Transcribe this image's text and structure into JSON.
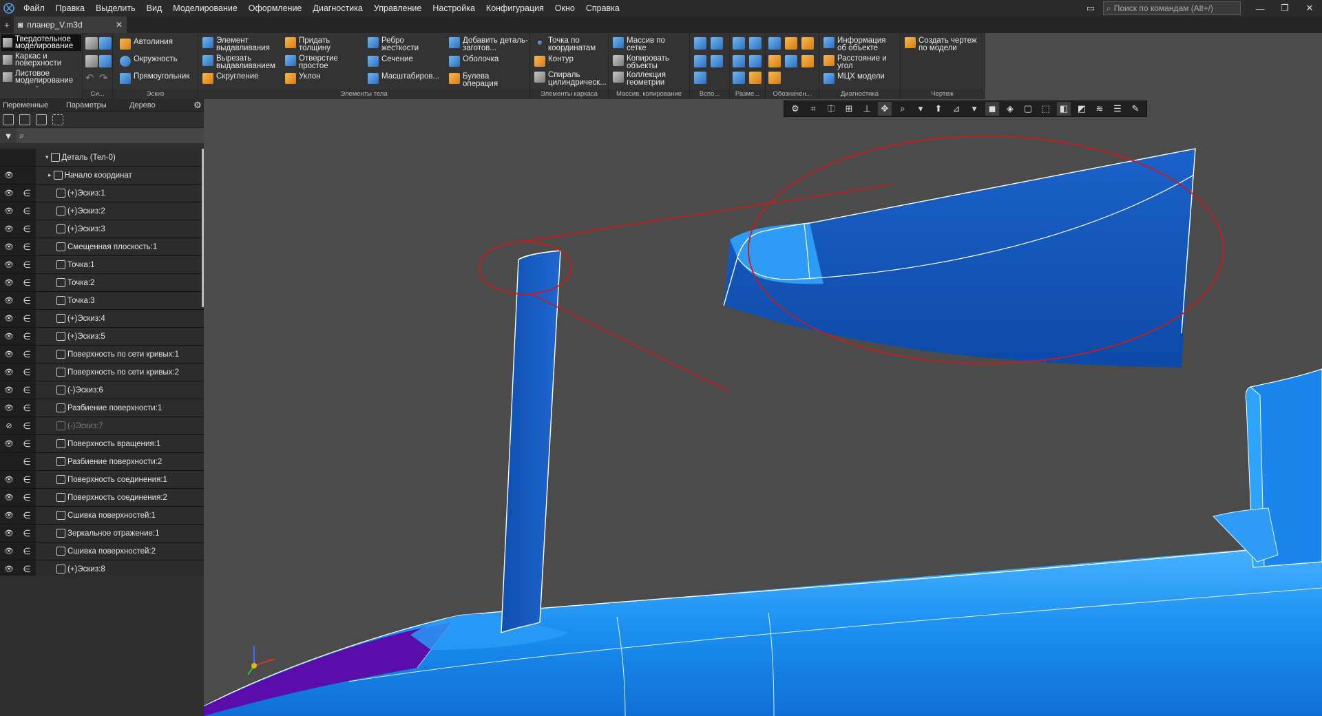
{
  "menu": {
    "items": [
      "Файл",
      "Правка",
      "Выделить",
      "Вид",
      "Моделирование",
      "Оформление",
      "Диагностика",
      "Управление",
      "Настройка",
      "Конфигурация",
      "Окно",
      "Справка"
    ],
    "search_placeholder": "Поиск по командам (Alt+/)"
  },
  "document": {
    "tab_title": "планер_V.m3d"
  },
  "ribbon": {
    "modes": [
      "Твердотельное моделирование",
      "Каркас и поверхности",
      "Листовое моделирование"
    ],
    "group_titles": {
      "sys": "Си...",
      "sketch": "Эскиз",
      "body": "Элементы тела",
      "wire": "Элементы каркаса",
      "array": "Массив, копирование",
      "aux": "Вспо...",
      "dims": "Разме...",
      "marks": "Обозначен...",
      "diag": "Диагностика",
      "drawing": "Чертеж"
    },
    "sketch": [
      "Автолиния",
      "Окружность",
      "Прямоугольник"
    ],
    "body_col1": [
      "Элемент выдавливания",
      "Вырезать выдавливанием",
      "Скругление"
    ],
    "body_col2": [
      "Придать толщину",
      "Отверстие простое",
      "Уклон"
    ],
    "body_col3": [
      "Ребро жесткости",
      "Сечение",
      "Масштабиров..."
    ],
    "body_col4": [
      "Добавить деталь-заготов...",
      "Оболочка",
      "Булева операция"
    ],
    "wire": [
      "Точка по координатам",
      "Контур",
      "Спираль цилиндрическ..."
    ],
    "array": [
      "Массив по сетке",
      "Копировать объекты",
      "Коллекция геометрии"
    ],
    "diag": [
      "Информация об объекте",
      "Расстояние и угол",
      "МЦХ модели"
    ],
    "drawing": [
      "Создать чертеж по модели"
    ]
  },
  "panel": {
    "tabs": [
      "Переменные",
      "Параметры",
      "Дерево"
    ]
  },
  "tree": {
    "root": "Деталь (Тел-0)",
    "origin": "Начало координат",
    "items": [
      "(+)Эскиз:1",
      "(+)Эскиз:2",
      "(+)Эскиз:3",
      "Смещенная плоскость:1",
      "Точка:1",
      "Точка:2",
      "Точка:3",
      "(+)Эскиз:4",
      "(+)Эскиз:5",
      "Поверхность по сети кривых:1",
      "Поверхность по сети кривых:2",
      "(-)Эскиз:6",
      "Разбиение поверхности:1",
      "(-)Эскиз:7",
      "Поверхность вращения:1",
      "Разбиение поверхности:2",
      "Поверхность соединения:1",
      "Поверхность соединения:2",
      "Сшивка поверхностей:1",
      "Зеркальное отражение:1",
      "Сшивка поверхностей:2",
      "(+)Эскиз:8"
    ]
  },
  "colors": {
    "fin": "#1e63c8",
    "fuselage": "#1e93ea",
    "canopy": "#5a0da8",
    "callout": "#c81c1c",
    "viewport_bg": "#4b4b4b"
  }
}
